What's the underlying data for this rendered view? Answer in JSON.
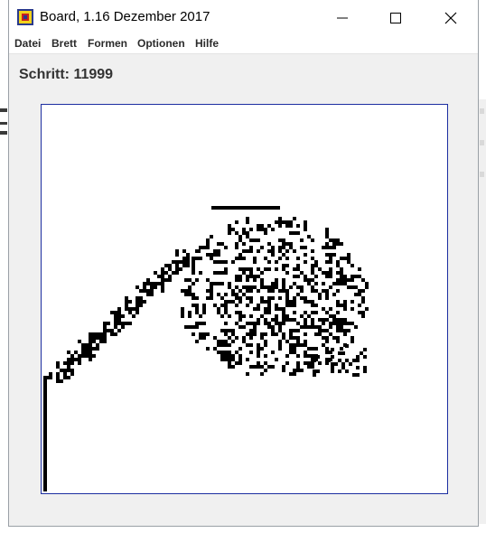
{
  "window": {
    "title": "Board, 1.16 Dezember 2017",
    "icon": "java-app-icon",
    "controls": [
      "minimize-icon",
      "maximize-icon",
      "close-icon"
    ]
  },
  "menu": {
    "items": [
      {
        "label": "Datei"
      },
      {
        "label": "Brett"
      },
      {
        "label": "Formen"
      },
      {
        "label": "Optionen"
      },
      {
        "label": "Hilfe"
      }
    ]
  },
  "status": {
    "step_text": "Schritt: 11999"
  },
  "board": {
    "cell_color": "#000000",
    "background": "#ffffff",
    "border_color": "#1c2ea0"
  }
}
